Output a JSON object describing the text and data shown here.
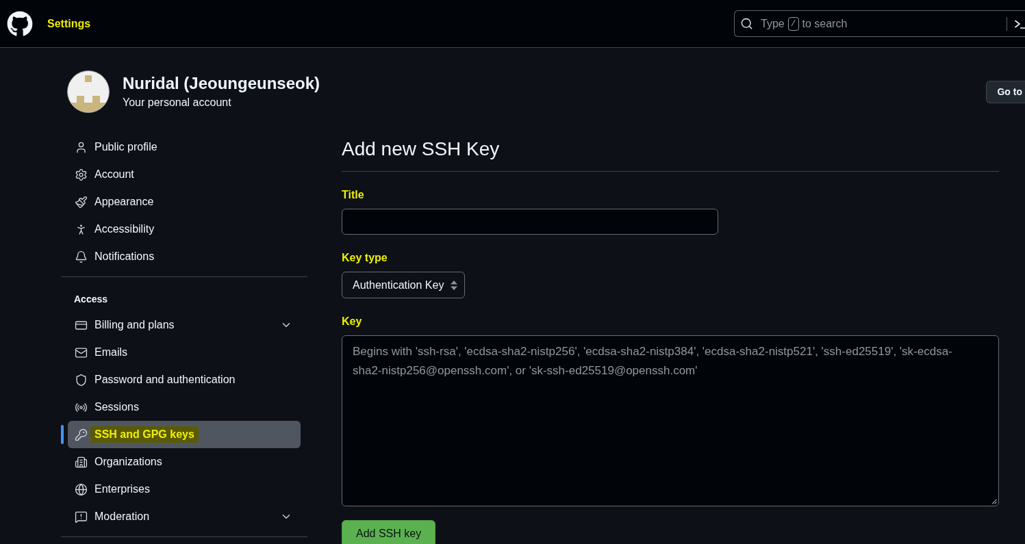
{
  "header": {
    "title": {
      "text": "Settings",
      "highlighted": true
    },
    "search": {
      "placeholder_before": "Type",
      "shortcut_key": "/",
      "placeholder_after": "to search"
    }
  },
  "profile": {
    "name": "Nuridal (Jeoungeunseok)",
    "subtitle": "Your personal account",
    "button": "Go to"
  },
  "sidebar": {
    "groups": [
      {
        "items": [
          {
            "label": "Public profile",
            "kind": "link",
            "selected": false,
            "highlighted": false
          },
          {
            "label": "Account",
            "kind": "link",
            "selected": false,
            "highlighted": false
          },
          {
            "label": "Appearance",
            "kind": "link",
            "selected": false,
            "highlighted": false
          },
          {
            "label": "Accessibility",
            "kind": "link",
            "selected": false,
            "highlighted": false
          },
          {
            "label": "Notifications",
            "kind": "link",
            "selected": false,
            "highlighted": false
          }
        ]
      },
      {
        "heading": "Access",
        "items": [
          {
            "label": "Billing and plans",
            "kind": "expandable",
            "selected": false,
            "highlighted": false
          },
          {
            "label": "Emails",
            "kind": "link",
            "selected": false,
            "highlighted": false
          },
          {
            "label": "Password and authentication",
            "kind": "link",
            "selected": false,
            "highlighted": false
          },
          {
            "label": "Sessions",
            "kind": "link",
            "selected": false,
            "highlighted": false
          },
          {
            "label": "SSH and GPG keys",
            "kind": "link",
            "selected": true,
            "highlighted": true
          },
          {
            "label": "Organizations",
            "kind": "link",
            "selected": false,
            "highlighted": false
          },
          {
            "label": "Enterprises",
            "kind": "link",
            "selected": false,
            "highlighted": false
          },
          {
            "label": "Moderation",
            "kind": "expandable",
            "selected": false,
            "highlighted": false
          }
        ]
      }
    ]
  },
  "form": {
    "heading": "Add new SSH Key",
    "fields": [
      {
        "kind": "text",
        "label": "Title",
        "highlighted": true
      },
      {
        "kind": "select",
        "label": "Key type",
        "highlighted": true,
        "value": "Authentication Key"
      },
      {
        "kind": "textarea",
        "label": "Key",
        "highlighted": true,
        "placeholder": "Begins with 'ssh-rsa', 'ecdsa-sha2-nistp256', 'ecdsa-sha2-nistp384', 'ecdsa-sha2-nistp521', 'ssh-ed25519', 'sk-ecdsa-sha2-nistp256@openssh.com', or 'sk-ssh-ed25519@openssh.com'"
      }
    ],
    "submit": "Add SSH key"
  }
}
